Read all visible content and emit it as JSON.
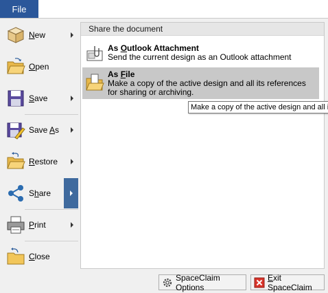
{
  "file_tab": {
    "label": "File"
  },
  "menu": {
    "items": [
      {
        "label": "New",
        "mnemonic": "N",
        "rest": "ew",
        "icon": "new-box-icon",
        "has_submenu": true
      },
      {
        "label": "Open",
        "mnemonic": "O",
        "rest": "pen",
        "icon": "open-folder-icon",
        "has_submenu": false
      },
      {
        "label": "Save",
        "mnemonic": "S",
        "rest": "ave",
        "icon": "save-disk-icon",
        "has_submenu": true
      },
      {
        "prefix": "Save ",
        "mnemonic": "A",
        "rest": "s",
        "label": "Save As",
        "icon": "save-as-icon",
        "has_submenu": true
      },
      {
        "label": "Restore",
        "mnemonic": "R",
        "rest": "estore",
        "icon": "restore-folder-icon",
        "has_submenu": true
      },
      {
        "label": "Share",
        "prefix": "S",
        "mnemonic": "h",
        "rest": "are",
        "icon": "share-icon",
        "has_submenu": true,
        "active": true
      },
      {
        "label": "Print",
        "mnemonic": "P",
        "rest": "rint",
        "icon": "printer-icon",
        "has_submenu": true
      },
      {
        "label": "Close",
        "mnemonic": "C",
        "rest": "lose",
        "icon": "close-folder-icon",
        "has_submenu": false
      }
    ]
  },
  "panel": {
    "header": "Share the document",
    "options": [
      {
        "title_prefix": "As ",
        "title_mnemonic": "O",
        "title_rest": "utlook Attachment",
        "title": "As Outlook Attachment",
        "description": "Send the current design as an Outlook attachment",
        "icon": "outlook-attachment-icon"
      },
      {
        "title_prefix": "As ",
        "title_mnemonic": "F",
        "title_rest": "ile",
        "title": "As File",
        "description": "Make a copy of the active design and all its references for sharing or archiving.",
        "icon": "file-folder-icon",
        "hovered": true
      }
    ]
  },
  "tooltip": {
    "text": "Make a copy of the active design and all its references for sharing or archiving."
  },
  "footer": {
    "options_label": "SpaceClaim Options",
    "exit_prefix": "E",
    "exit_rest": "xit SpaceClaim",
    "exit_label": "Exit SpaceClaim"
  },
  "colors": {
    "file_tab": "#2b579a",
    "active_arrow_box": "#3f6a9e",
    "hover_bg": "#c8c8c8"
  }
}
